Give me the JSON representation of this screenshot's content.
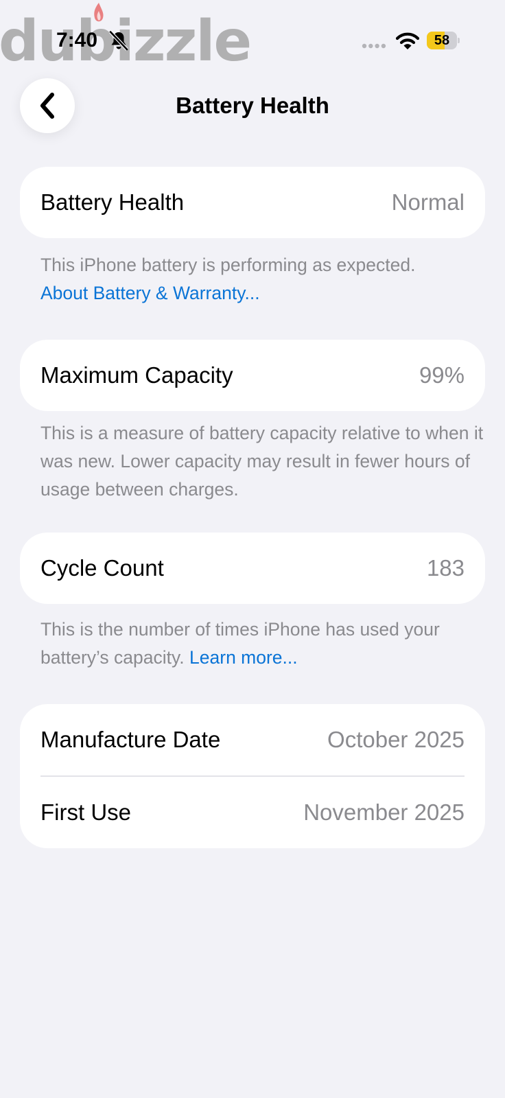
{
  "status_bar": {
    "watermark": "dubizzle",
    "time": "7:40",
    "battery_level": "58",
    "battery_fraction": 0.58,
    "battery_color": "#f4c81b"
  },
  "nav": {
    "title": "Battery Health"
  },
  "battery_health": {
    "label": "Battery Health",
    "value": "Normal",
    "footnote": "This iPhone battery is performing as expected.",
    "link": "About Battery & Warranty..."
  },
  "maximum_capacity": {
    "label": "Maximum Capacity",
    "value": "99%",
    "footnote": "This is a measure of battery capacity relative to when it was new. Lower capacity may result in fewer hours of usage between charges."
  },
  "cycle_count": {
    "label": "Cycle Count",
    "value": "183",
    "footnote": "This is the number of times iPhone has used your battery’s capacity.",
    "link": "Learn more..."
  },
  "dates": {
    "manufacture_label": "Manufacture Date",
    "manufacture_value": "October 2025",
    "first_use_label": "First Use",
    "first_use_value": "November 2025"
  },
  "colors": {
    "background": "#f2f2f7",
    "link": "#0a74d6",
    "secondary_text": "#8a8a8e"
  },
  "icons": [
    "back-chevron-icon",
    "bell-slash-icon",
    "wifi-icon",
    "battery-icon",
    "cellular-signal-icon"
  ]
}
